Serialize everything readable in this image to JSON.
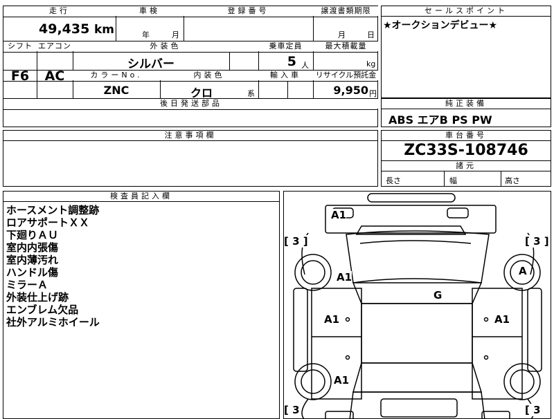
{
  "top": {
    "mileage_label": "走行",
    "mileage_value": "49,435",
    "mileage_unit": "km",
    "inspection_label": "車検",
    "inspection_year_unit": "年",
    "inspection_month_unit": "月",
    "registration_label": "登録番号",
    "transfer_label": "譲渡書類期限",
    "transfer_month_unit": "月",
    "transfer_day_unit": "日",
    "shift_label": "シフト",
    "shift_value": "F6",
    "ac_label": "エアコン",
    "ac_value": "AC",
    "exterior_color_label": "外装色",
    "exterior_color_value": "シルバー",
    "capacity_label": "乗車定員",
    "capacity_value": "5",
    "capacity_unit": "人",
    "max_load_label": "最大積載量",
    "max_load_unit": "kg",
    "color_no_label": "カラーNo.",
    "color_no_value": "ZNC",
    "interior_label": "内装色",
    "interior_value": "クロ",
    "interior_unit": "系",
    "import_label": "輸入車",
    "recycle_label": "リサイクル預託金",
    "recycle_value": "9,950",
    "recycle_unit": "円",
    "later_parts_label": "後日発送部品"
  },
  "sales_point": {
    "label": "セールスポイント",
    "text": "★オークションデビュー★"
  },
  "genuine_equipment": {
    "label": "純正装備",
    "text": "ABS エアB PS PW"
  },
  "notes": {
    "label": "注意事項欄"
  },
  "chassis": {
    "label": "車台番号",
    "value": "ZC33S-108746",
    "specs_label": "諸元",
    "length_label": "長さ",
    "width_label": "幅",
    "height_label": "高さ"
  },
  "inspector": {
    "label": "検査員記入欄",
    "items": [
      "ホースメント調整跡",
      "ロアサポートＸＸ",
      "下廻りＡＵ",
      "室内内張傷",
      "室内薄汚れ",
      "ハンドル傷",
      "ミラーＡ",
      "外装仕上げ跡",
      "エンブレム欠品",
      "社外アルミホイール"
    ]
  },
  "diagram": {
    "marks": {
      "front_bumper": "A1",
      "hood": "A1",
      "roof": "G",
      "left_front_door": "A1",
      "right_front_door": "A1",
      "left_rear": "A1",
      "right_front_wheel": "A",
      "bracket_tl": "[ 3 ]",
      "bracket_tr": "[ 3 ]",
      "bracket_bl": "[ 3",
      "bracket_br": "[ 3"
    }
  }
}
